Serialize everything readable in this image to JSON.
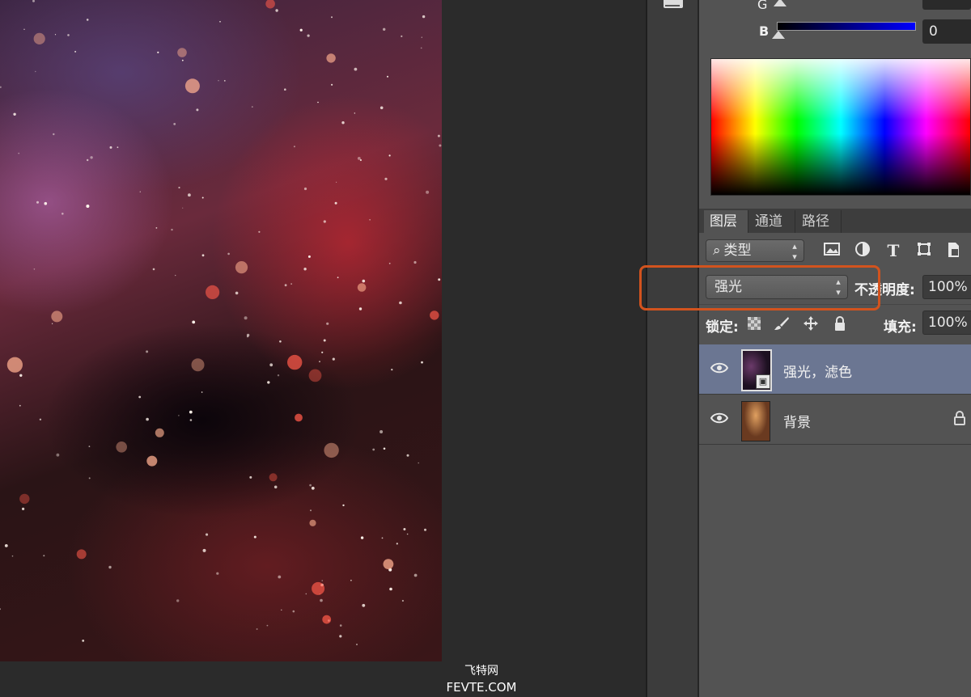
{
  "watermark": {
    "site_cn": "飞特网",
    "site_en": "FEVTE.COM"
  },
  "color_panel": {
    "b_label": "B",
    "b_value": "0",
    "b_track_colors": [
      "#000000",
      "#0000ff"
    ]
  },
  "layers_panel": {
    "tabs": [
      {
        "label": "图层",
        "active": true
      },
      {
        "label": "通道",
        "active": false
      },
      {
        "label": "路径",
        "active": false
      }
    ],
    "filter": {
      "kind_label": "类型",
      "icons": [
        "image-filter-icon",
        "adjustment-filter-icon",
        "type-filter-icon",
        "shape-filter-icon",
        "smart-object-filter-icon"
      ],
      "type_glyph": "T"
    },
    "blend_mode": "强光",
    "opacity_label": "不透明度:",
    "opacity_value": "100%",
    "lock_label": "锁定:",
    "fill_label": "填充:",
    "fill_value": "100%",
    "layers": [
      {
        "name": "强光，滤色",
        "visible": true,
        "selected": true,
        "smart_object": true
      },
      {
        "name": "背景",
        "visible": true,
        "selected": false,
        "locked": true
      }
    ]
  },
  "colors": {
    "accent_highlight": "#d2531e",
    "selected_layer": "#6b7692",
    "panel_bg": "#535353"
  }
}
